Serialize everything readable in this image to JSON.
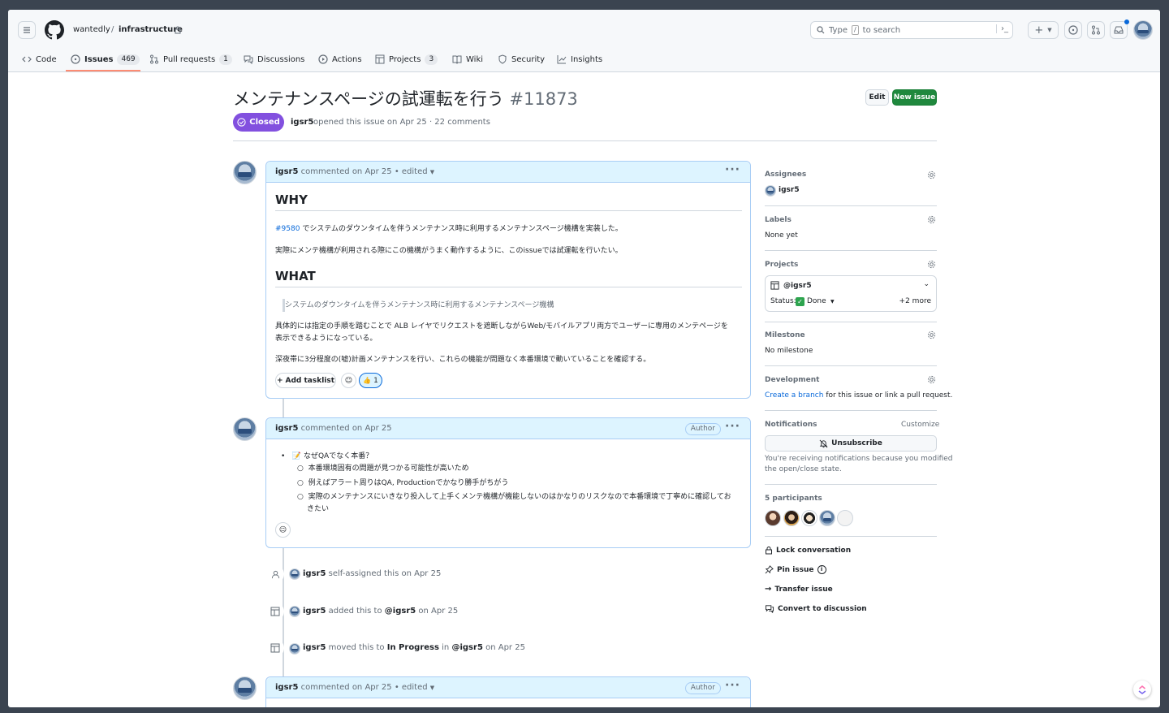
{
  "header": {
    "org": "wantedly",
    "slash": "/",
    "repo": "infrastructure",
    "search_placeholder": "Type / to search",
    "search_type": "Type",
    "search_key": "/",
    "search_rest": "to search",
    "plus": "+"
  },
  "tabs": [
    {
      "label": "Code",
      "icon": "code-icon"
    },
    {
      "label": "Issues",
      "count": "469",
      "icon": "issue-icon"
    },
    {
      "label": "Pull requests",
      "count": "1",
      "icon": "pr-icon"
    },
    {
      "label": "Discussions",
      "icon": "discussion-icon"
    },
    {
      "label": "Actions",
      "icon": "play-icon"
    },
    {
      "label": "Projects",
      "count": "3",
      "icon": "table-icon"
    },
    {
      "label": "Wiki",
      "icon": "book-icon"
    },
    {
      "label": "Security",
      "icon": "shield-icon"
    },
    {
      "label": "Insights",
      "icon": "graph-icon"
    }
  ],
  "issue": {
    "title": "メンテナンスページの試運転を行う",
    "number": "#11873",
    "state": "Closed",
    "author": "igsr5",
    "meta": "opened this issue on Apr 25 · 22 comments",
    "edit": "Edit",
    "new_issue": "New issue"
  },
  "comment1": {
    "author": "igsr5",
    "meta": "commented on Apr 25 • edited",
    "h_why": "WHY",
    "ref": "#9580",
    "p1": "でシステムのダウンタイムを伴うメンテナンス時に利用するメンテナンスページ機構を実装した。",
    "p2": "実際にメンテ機構が利用される際にこの機構がうまく動作するように、このissueでは試運転を行いたい。",
    "h_what": "WHAT",
    "quote": "システムのダウンタイムを伴うメンテナンス時に利用するメンテナンスページ機構",
    "p3a": "具体的には指定の手順を踏むことで ALB レイヤでリクエストを遮断しながらWeb/モバイルアプリ両方でユーザーに専用のメンテページを",
    "p3b": "表示できるようになっている。",
    "p4": "深夜帯に3分程度の(嘘)計画メンテナンスを行い、これらの機能が問題なく本番環境で動いていることを確認する。",
    "tasklist": "Add tasklist",
    "reaction": "👍",
    "reaction_count": "1"
  },
  "comment2": {
    "author": "igsr5",
    "meta": "commented on Apr 25",
    "badge": "Author",
    "bullet": "📝 なぜQAでなく本番？",
    "items": [
      "本番環境固有の問題が見つかる可能性が高いため",
      "例えばアラート周りはQA, Productionでかなり勝手がちがう",
      "実際のメンテナンスにいきなり投入して上手くメンテ機構が機能しないのはかなりのリスクなので本番環境で丁寧めに確認してお"
    ],
    "item3b": "きたい"
  },
  "events": [
    {
      "user": "igsr5",
      "text": "self-assigned this on Apr 25"
    },
    {
      "user": "igsr5",
      "text": "added this to",
      "target": "@igsr5",
      "tail": "on Apr 25"
    },
    {
      "user": "igsr5",
      "text": "moved this to",
      "target": "In Progress",
      "mid": "in",
      "target2": "@igsr5",
      "tail": "on Apr 25"
    }
  ],
  "comment3": {
    "author": "igsr5",
    "meta": "commented on Apr 25 • edited",
    "badge": "Author"
  },
  "sidebar": {
    "assignees_h": "Assignees",
    "assignee": "igsr5",
    "labels_h": "Labels",
    "labels_v": "None yet",
    "projects_h": "Projects",
    "project": "@igsr5",
    "status_label": "Status:",
    "status": "Done",
    "more": "+2 more",
    "milestone_h": "Milestone",
    "milestone_v": "No milestone",
    "dev_h": "Development",
    "dev_link": "Create a branch",
    "dev_rest": "for this issue or link a pull request.",
    "notif_h": "Notifications",
    "customize": "Customize",
    "unsubscribe": "Unsubscribe",
    "notif_1": "You're receiving notifications because you modified",
    "notif_2": "the open/close state.",
    "participants_h": "5 participants",
    "lock": "Lock conversation",
    "pin": "Pin issue",
    "transfer": "Transfer issue",
    "convert": "Convert to discussion"
  }
}
